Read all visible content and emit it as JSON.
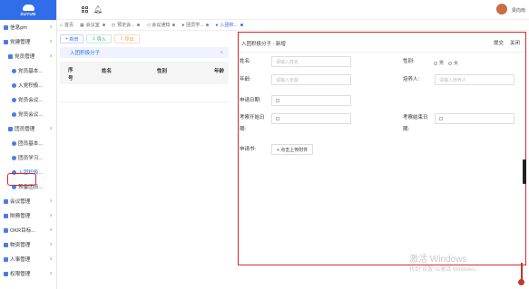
{
  "app": {
    "logo_text": "SUYUN",
    "username": "梁向南"
  },
  "sidebar": {
    "items": [
      {
        "label": "信息pm",
        "level": 1
      },
      {
        "label": "党建管理",
        "level": 1
      },
      {
        "label": "党员管理",
        "level": 2
      },
      {
        "label": "党员基本...",
        "level": 3
      },
      {
        "label": "入党积极...",
        "level": 3
      },
      {
        "label": "党员会议...",
        "level": 3
      },
      {
        "label": "党员会议...",
        "level": 3
      },
      {
        "label": "团员管理",
        "level": 2
      },
      {
        "label": "团员基本...",
        "level": 3
      },
      {
        "label": "团员学习...",
        "level": 3
      },
      {
        "label": "入团积极...",
        "level": 3
      },
      {
        "label": "预备团员...",
        "level": 3
      },
      {
        "label": "会议管理",
        "level": 1
      },
      {
        "label": "財務管理",
        "level": 1
      },
      {
        "label": "OKR目标...",
        "level": 1
      },
      {
        "label": "物资管理",
        "level": 1
      },
      {
        "label": "人事管理",
        "level": 1
      },
      {
        "label": "权限管理",
        "level": 1
      }
    ]
  },
  "tabs": [
    {
      "label": "首页"
    },
    {
      "label": "会议室"
    },
    {
      "label": "预定会..."
    },
    {
      "label": "会议通知"
    },
    {
      "label": "团员学..."
    },
    {
      "label": "入团积..."
    }
  ],
  "list": {
    "buttons": {
      "add": "新增",
      "import": "导入",
      "export": "导出"
    },
    "section_title": "入团积极分子",
    "columns": {
      "seq": "序号",
      "name": "姓名",
      "gender": "性别",
      "age": "年龄"
    }
  },
  "form": {
    "title": "入团积极分子 - 新增",
    "submit": "提交",
    "close": "关闭",
    "name_label": "姓名:",
    "name_placeholder": "请输入姓名",
    "gender_label": "性别:",
    "gender_male": "男",
    "gender_female": "女",
    "age_label": "年龄:",
    "age_placeholder": "请输入年龄",
    "referrer_label": "培养人:",
    "referrer_placeholder": "请输入培养人",
    "apply_date_label": "申请日期:",
    "apply_date_placeholder": "",
    "review_start_label_1": "考察开始日",
    "review_start_label_2": "期:",
    "review_start_placeholder": "",
    "review_end_label_1": "考察结束日",
    "review_end_label_2": "期:",
    "review_end_placeholder": "",
    "application_label": "申请书:",
    "upload_button": "+ 点击上传附件"
  },
  "watermark": {
    "line1": "激活 Windows",
    "line2": "转到\"设置\"以激活 Windows。"
  },
  "colors": {
    "accent": "#2f6ee8",
    "highlight": "#d9262e"
  }
}
